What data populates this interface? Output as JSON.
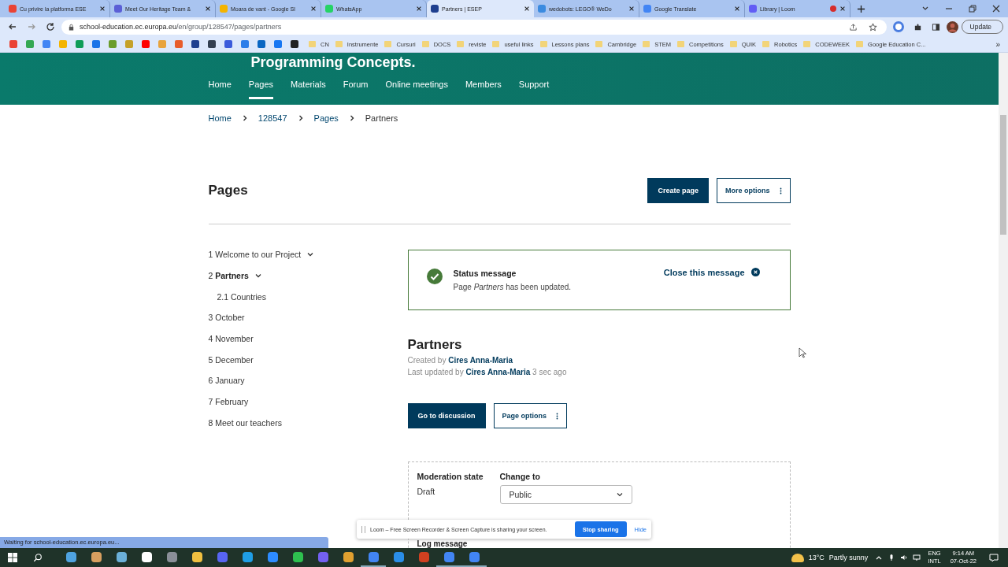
{
  "browser": {
    "tabs": [
      {
        "title": "Cu privire la platforma ESE",
        "selected": false,
        "color": "#ea4335",
        "recording": false
      },
      {
        "title": "Meet Our Heritage Team &",
        "selected": false,
        "color": "#5b5fd6",
        "recording": false
      },
      {
        "title": "Moara de vant - Google Sl",
        "selected": false,
        "color": "#f4b400",
        "recording": false
      },
      {
        "title": "WhatsApp",
        "selected": false,
        "color": "#25d366",
        "recording": false
      },
      {
        "title": "Partners | ESEP",
        "selected": true,
        "color": "#1f3f8f",
        "recording": false
      },
      {
        "title": "wedobots: LEGO® WeDo",
        "selected": false,
        "color": "#3b8be0",
        "recording": false
      },
      {
        "title": "Google Translate",
        "selected": false,
        "color": "#4285f4",
        "recording": false
      },
      {
        "title": "Library | Loom",
        "selected": false,
        "color": "#625df5",
        "recording": true
      }
    ],
    "address": {
      "host": "school-education.ec.europa.eu",
      "path": "/en/group/128547/pages/partners"
    },
    "update_button": "Update",
    "bookmark_folders": [
      "CN",
      "Instrumente",
      "Cursuri",
      "DOCS",
      "reviste",
      "useful links",
      "Lessons plans",
      "Cambridge",
      "STEM",
      "Competitions",
      "QUIK",
      "Robotics",
      "CODEWEEK",
      "Google Education C..."
    ],
    "bookmarks_overflow": "»"
  },
  "header": {
    "title": "Programming Concepts.",
    "nav": [
      {
        "label": "Home",
        "selected": false
      },
      {
        "label": "Pages",
        "selected": true
      },
      {
        "label": "Materials",
        "selected": false
      },
      {
        "label": "Forum",
        "selected": false
      },
      {
        "label": "Online meetings",
        "selected": false
      },
      {
        "label": "Members",
        "selected": false
      },
      {
        "label": "Support",
        "selected": false
      }
    ]
  },
  "breadcrumb": [
    "Home",
    "128547",
    "Pages",
    "Partners"
  ],
  "pages_heading": "Pages",
  "create_button": "Create page",
  "more_options_button": "More options",
  "sidebar": {
    "items": [
      {
        "number": "1",
        "label": "Welcome to our Project",
        "selected": false,
        "expandable": true
      },
      {
        "number": "2",
        "label": "Partners",
        "selected": true,
        "expandable": true,
        "children": [
          {
            "number": "2.1",
            "label": "Countries",
            "selected": false,
            "expandable": false
          }
        ]
      },
      {
        "number": "3",
        "label": "October",
        "selected": false,
        "expandable": false
      },
      {
        "number": "4",
        "label": "November",
        "selected": false,
        "expandable": false
      },
      {
        "number": "5",
        "label": "December",
        "selected": false,
        "expandable": false
      },
      {
        "number": "6",
        "label": "January",
        "selected": false,
        "expandable": false
      },
      {
        "number": "7",
        "label": "February",
        "selected": false,
        "expandable": false
      },
      {
        "number": "8",
        "label": "Meet our teachers",
        "selected": false,
        "expandable": false
      }
    ]
  },
  "status_message": {
    "title": "Status message",
    "text": "Page *Partners* has been updated.",
    "close": "Close this message"
  },
  "article": {
    "title": "Partners",
    "created_label": "Created by",
    "created_author": "Cires Anna-Maria",
    "updated_label": "Last updated by",
    "updated_author": "Cires Anna-Maria",
    "updated_time": "3 sec ago",
    "discussion_button": "Go to discussion",
    "page_options_button": "Page options"
  },
  "moderation": {
    "state_label": "Moderation state",
    "state": "Draft",
    "change_label": "Change to",
    "change_value": "Public",
    "log_label": "Log message"
  },
  "status_bar": "Waiting for school-education.ec.europa.eu...",
  "loom": {
    "text": "Loom – Free Screen Recorder & Screen Capture is sharing your screen.",
    "stop": "Stop sharing",
    "hide": "Hide"
  },
  "taskbar": {
    "temperature": "13°C",
    "weather": "Partly sunny",
    "lang": "ENG",
    "layout": "INTL",
    "time": "9:14 AM",
    "date": "07-Oct-22"
  }
}
